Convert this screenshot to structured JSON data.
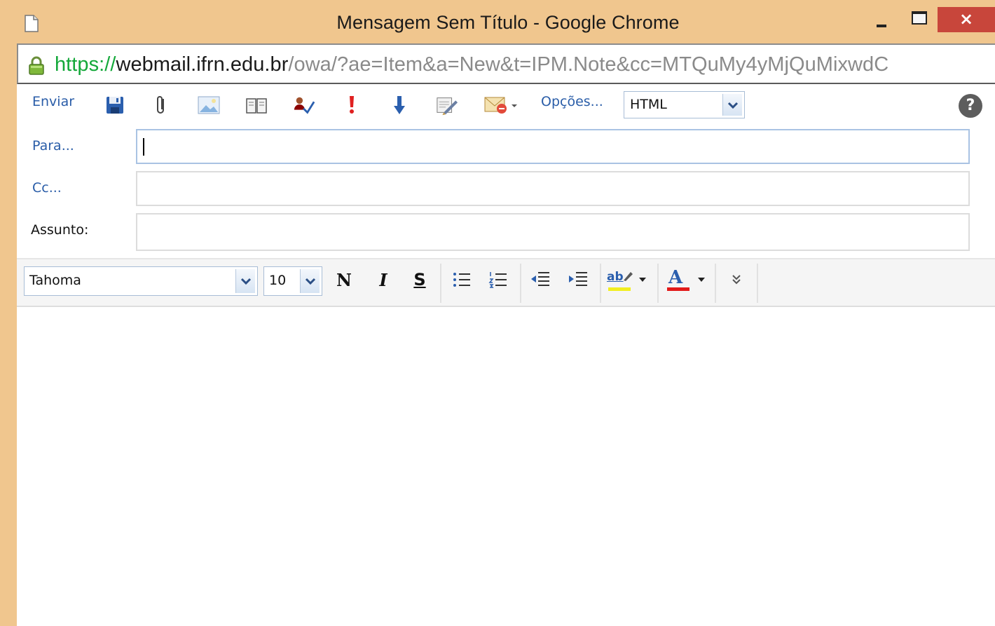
{
  "window": {
    "title": "Mensagem Sem Título - Google Chrome",
    "close_glyph": "×"
  },
  "address": {
    "scheme": "https://",
    "host": "webmail.ifrn.edu.br",
    "path": "/owa/?ae=Item&a=New&t=IPM.Note&cc=MTQuMy4yMjQuMixwdC"
  },
  "toolbar": {
    "send_label": "Enviar",
    "options_label": "Opções...",
    "format_value": "HTML",
    "help_glyph": "?",
    "icons": [
      "save-icon",
      "attach-icon",
      "insert-image-icon",
      "address-book-icon",
      "check-names-icon",
      "high-importance-icon",
      "low-importance-icon",
      "signature-icon",
      "message-flag-icon"
    ]
  },
  "fields": {
    "to_label": "Para...",
    "cc_label": "Cc...",
    "subject_label": "Assunto:",
    "to_value": "",
    "cc_value": "",
    "subject_value": ""
  },
  "format": {
    "font_value": "Tahoma",
    "size_value": "10",
    "bold_label": "N",
    "italic_label": "I",
    "strike_label": "S",
    "highlight_label": "ab",
    "font_color_label": "A",
    "colors": {
      "highlight": "#f2ee1f",
      "font_color": "#e21a1a"
    }
  },
  "colors": {
    "frame": "#f0c68e",
    "link": "#2a5da8",
    "close_button": "#c8463b",
    "url_scheme": "#14a83a"
  }
}
